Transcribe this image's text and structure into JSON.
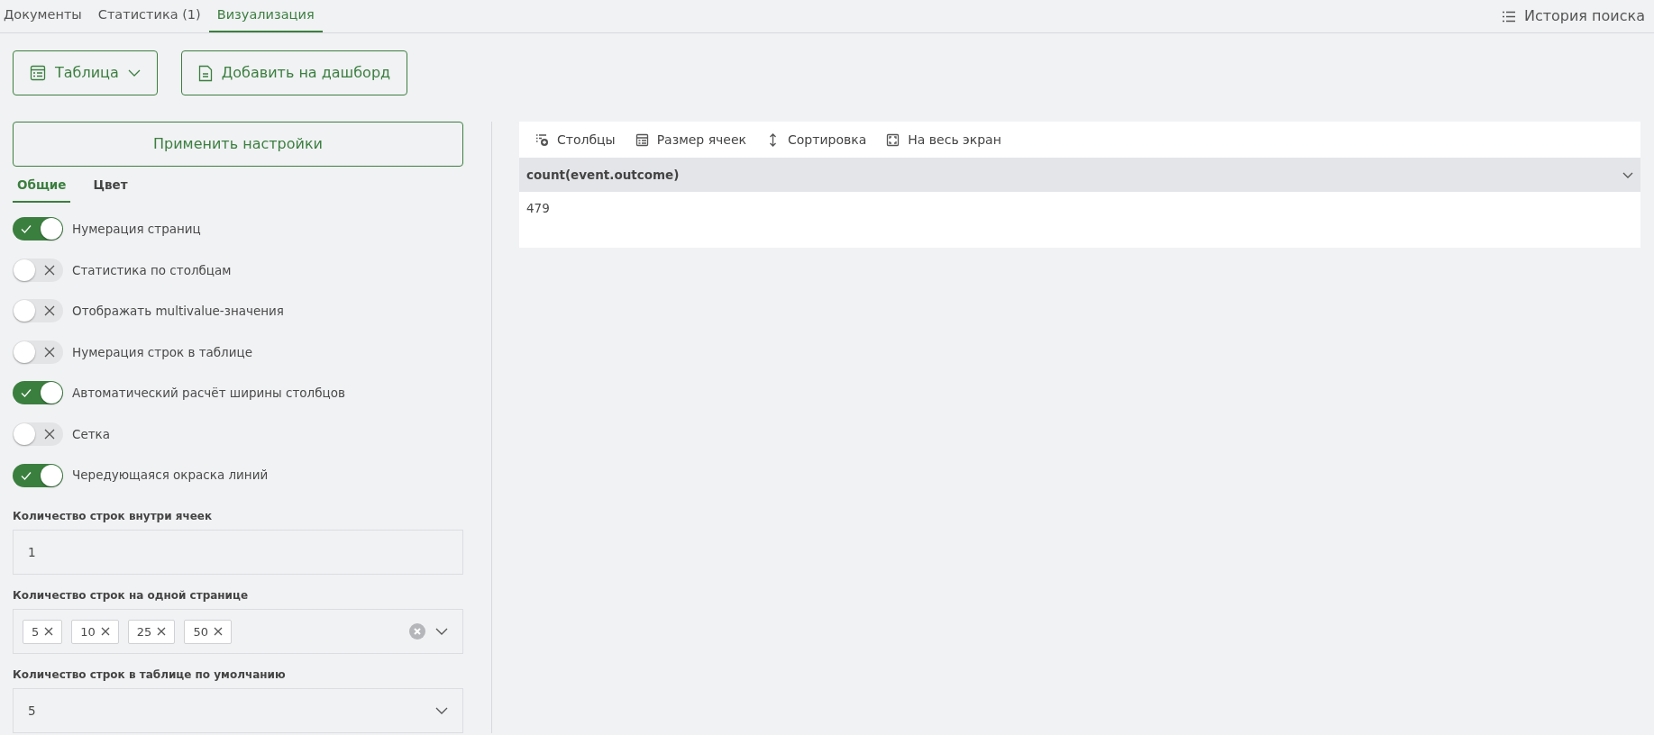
{
  "top_tabs": [
    {
      "label": "Документы",
      "selected": false
    },
    {
      "label": "Статистика (1)",
      "selected": false
    },
    {
      "label": "Визуализация",
      "selected": true
    }
  ],
  "history_button": {
    "label": "История поиска"
  },
  "view_select": {
    "label": "Таблица"
  },
  "add_dashboard_button": {
    "label": "Добавить на дашборд"
  },
  "apply_button": {
    "label": "Применить настройки"
  },
  "settings_tabs": [
    {
      "label": "Общие",
      "selected": true
    },
    {
      "label": "Цвет",
      "selected": false
    }
  ],
  "toggles": [
    {
      "label": "Нумерация страниц",
      "on": true
    },
    {
      "label": "Статистика по столбцам",
      "on": false
    },
    {
      "label": "Отображать multivalue-значения",
      "on": false
    },
    {
      "label": "Нумерация строк в таблице",
      "on": false
    },
    {
      "label": "Автоматический расчёт ширины столбцов",
      "on": true
    },
    {
      "label": "Сетка",
      "on": false
    },
    {
      "label": "Чередующаяся окраска линий",
      "on": true
    }
  ],
  "fields": [
    {
      "kind": "input",
      "label": "Количество строк внутри ячеек",
      "value": "1"
    },
    {
      "kind": "tags",
      "label": "Количество строк на одной странице",
      "tags": [
        "5",
        "10",
        "25",
        "50"
      ]
    },
    {
      "kind": "select",
      "label": "Количество строк в таблице по умолчанию",
      "value": "5"
    }
  ],
  "table_toolbar": [
    {
      "label": "Столбцы"
    },
    {
      "label": "Размер ячеек"
    },
    {
      "label": "Сортировка"
    },
    {
      "label": "На весь экран"
    }
  ],
  "table": {
    "columns": [
      "count(event.outcome)"
    ],
    "rows": [
      [
        "479"
      ]
    ]
  }
}
